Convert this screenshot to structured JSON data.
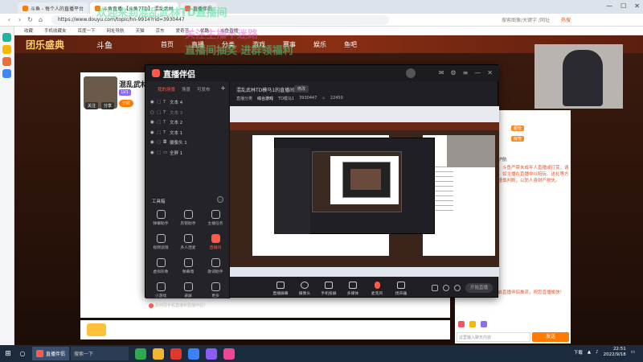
{
  "browser": {
    "tabs": [
      {
        "label": "斗鱼 - 每个人的直播平台"
      },
      {
        "label": "斗鱼直播 【斗鱼7TD】 混乱武林"
      },
      {
        "label": "直播伴侣"
      }
    ],
    "url": "https://www.douyu.com/topic/hn-9914?rid=3930447",
    "search_placeholder": "搜索图像/关键字 /网址",
    "hot_label": "热搜",
    "bookmarks": [
      "收藏",
      "手机收藏夹",
      "百度一下",
      "网址导航",
      "天猫",
      "京东",
      "爱奇艺",
      "优酷",
      "斗鱼直播"
    ]
  },
  "douyu": {
    "logo": "斗鱼",
    "nav": [
      "首页",
      "直播",
      "分类",
      "游戏",
      "赛事",
      "娱乐",
      "鱼吧"
    ],
    "festival": "团乐盛典",
    "anchor_name": "混乱武林",
    "level_badge": "LV1",
    "subscribe": "订阅",
    "follow_labels": [
      "关注",
      "分享"
    ],
    "chat_badges": [
      "超管",
      "超管",
      "房管"
    ],
    "notice_title": "为您的开播安全保驾护航",
    "notice_text": "欢迎来到斗鱼直播间，斗鱼严禁未成年人直播或打赏，请理性消费，谨防诈骗，如主播在直播中以陪玩、送礼等方式诱导私下交易，请谨慎判断，以防人身财产损失。",
    "notice2_text": "【系统消息】恭喜开启直播伴侣推流，祝您直播愉快！",
    "chat_placeholder": "这里输入聊天内容",
    "send_label": "发送"
  },
  "overlay": {
    "line1": "欢迎来到混乱武林TD直播间",
    "line2": "关注主播不迷路",
    "line3": "直播间抽奖 进群领福利"
  },
  "companion": {
    "logo": "直播伴侣",
    "room_title": "混乱武林TD模马1的直播间",
    "edit_label": "修改",
    "category_prefix": "直播分类",
    "category": "综合游戏",
    "room_id_label": "TD模马1",
    "room_id": "3930447",
    "heat": "22450",
    "scene_tabs": [
      "我的场景",
      "场景",
      "可发布"
    ],
    "layers": [
      {
        "label": "文本 4",
        "dim": false
      },
      {
        "label": "文本 3",
        "dim": true
      },
      {
        "label": "文本 2",
        "dim": false
      },
      {
        "label": "文本 1",
        "dim": false
      },
      {
        "label": "摄像头 1",
        "dim": false
      },
      {
        "label": "全屏 1",
        "dim": false
      }
    ],
    "tools_title": "工具箱",
    "tools": [
      {
        "label": "弹幕助手",
        "hot": false
      },
      {
        "label": "房管助手",
        "hot": false
      },
      {
        "label": "主播任务",
        "hot": false
      },
      {
        "label": "视频滤镜",
        "hot": false
      },
      {
        "label": "多人连麦",
        "hot": false
      },
      {
        "label": "直播间",
        "hot": true
      },
      {
        "label": "虚拟形象",
        "hot": false
      },
      {
        "label": "弹幕墙",
        "hot": false
      },
      {
        "label": "歌词助手",
        "hot": false
      },
      {
        "label": "小游戏",
        "hot": false
      },
      {
        "label": "录屏",
        "hot": false
      },
      {
        "label": "更多",
        "hot": false
      }
    ],
    "tip": "如何把手机直播到直播伴侣？",
    "controls": [
      "直播屏幕",
      "摄像头",
      "手机投屏",
      "多媒体",
      "麦克风",
      "扬声器"
    ],
    "go_live": "开始直播"
  },
  "taskbar": {
    "active_app": "直播伴侣",
    "search_placeholder": "搜索一下",
    "clock_time": "22:51",
    "clock_date": "2022/9/18",
    "tray_text": "下载"
  }
}
